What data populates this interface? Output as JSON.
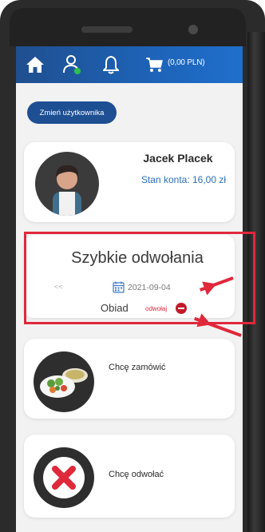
{
  "nav": {
    "cart_amount": "(0,00 PLN)"
  },
  "switch_user": {
    "label": "Zmień użytkownika"
  },
  "user": {
    "name": "Jacek Placek",
    "balance": "Stan konta: 16,00 zł"
  },
  "quick_cancel": {
    "title": "Szybkie odwołania",
    "prev": "<<",
    "next": ">>",
    "date": "2021-09-04",
    "meal": "Obiad",
    "cancel_link": "odwołaj"
  },
  "actions": {
    "order_label": "Chcę zamówić",
    "cancel_label": "Chcę odwołać"
  },
  "colors": {
    "nav_blue": "#1e63b8",
    "button_blue": "#1e4f93",
    "highlight_red": "#e0283b",
    "success_green": "#2ec24a"
  },
  "icons": [
    "home-icon",
    "user-icon",
    "bell-icon",
    "cart-icon",
    "calendar-icon",
    "minus-circle-icon",
    "meal-icon",
    "cancel-x-icon"
  ]
}
